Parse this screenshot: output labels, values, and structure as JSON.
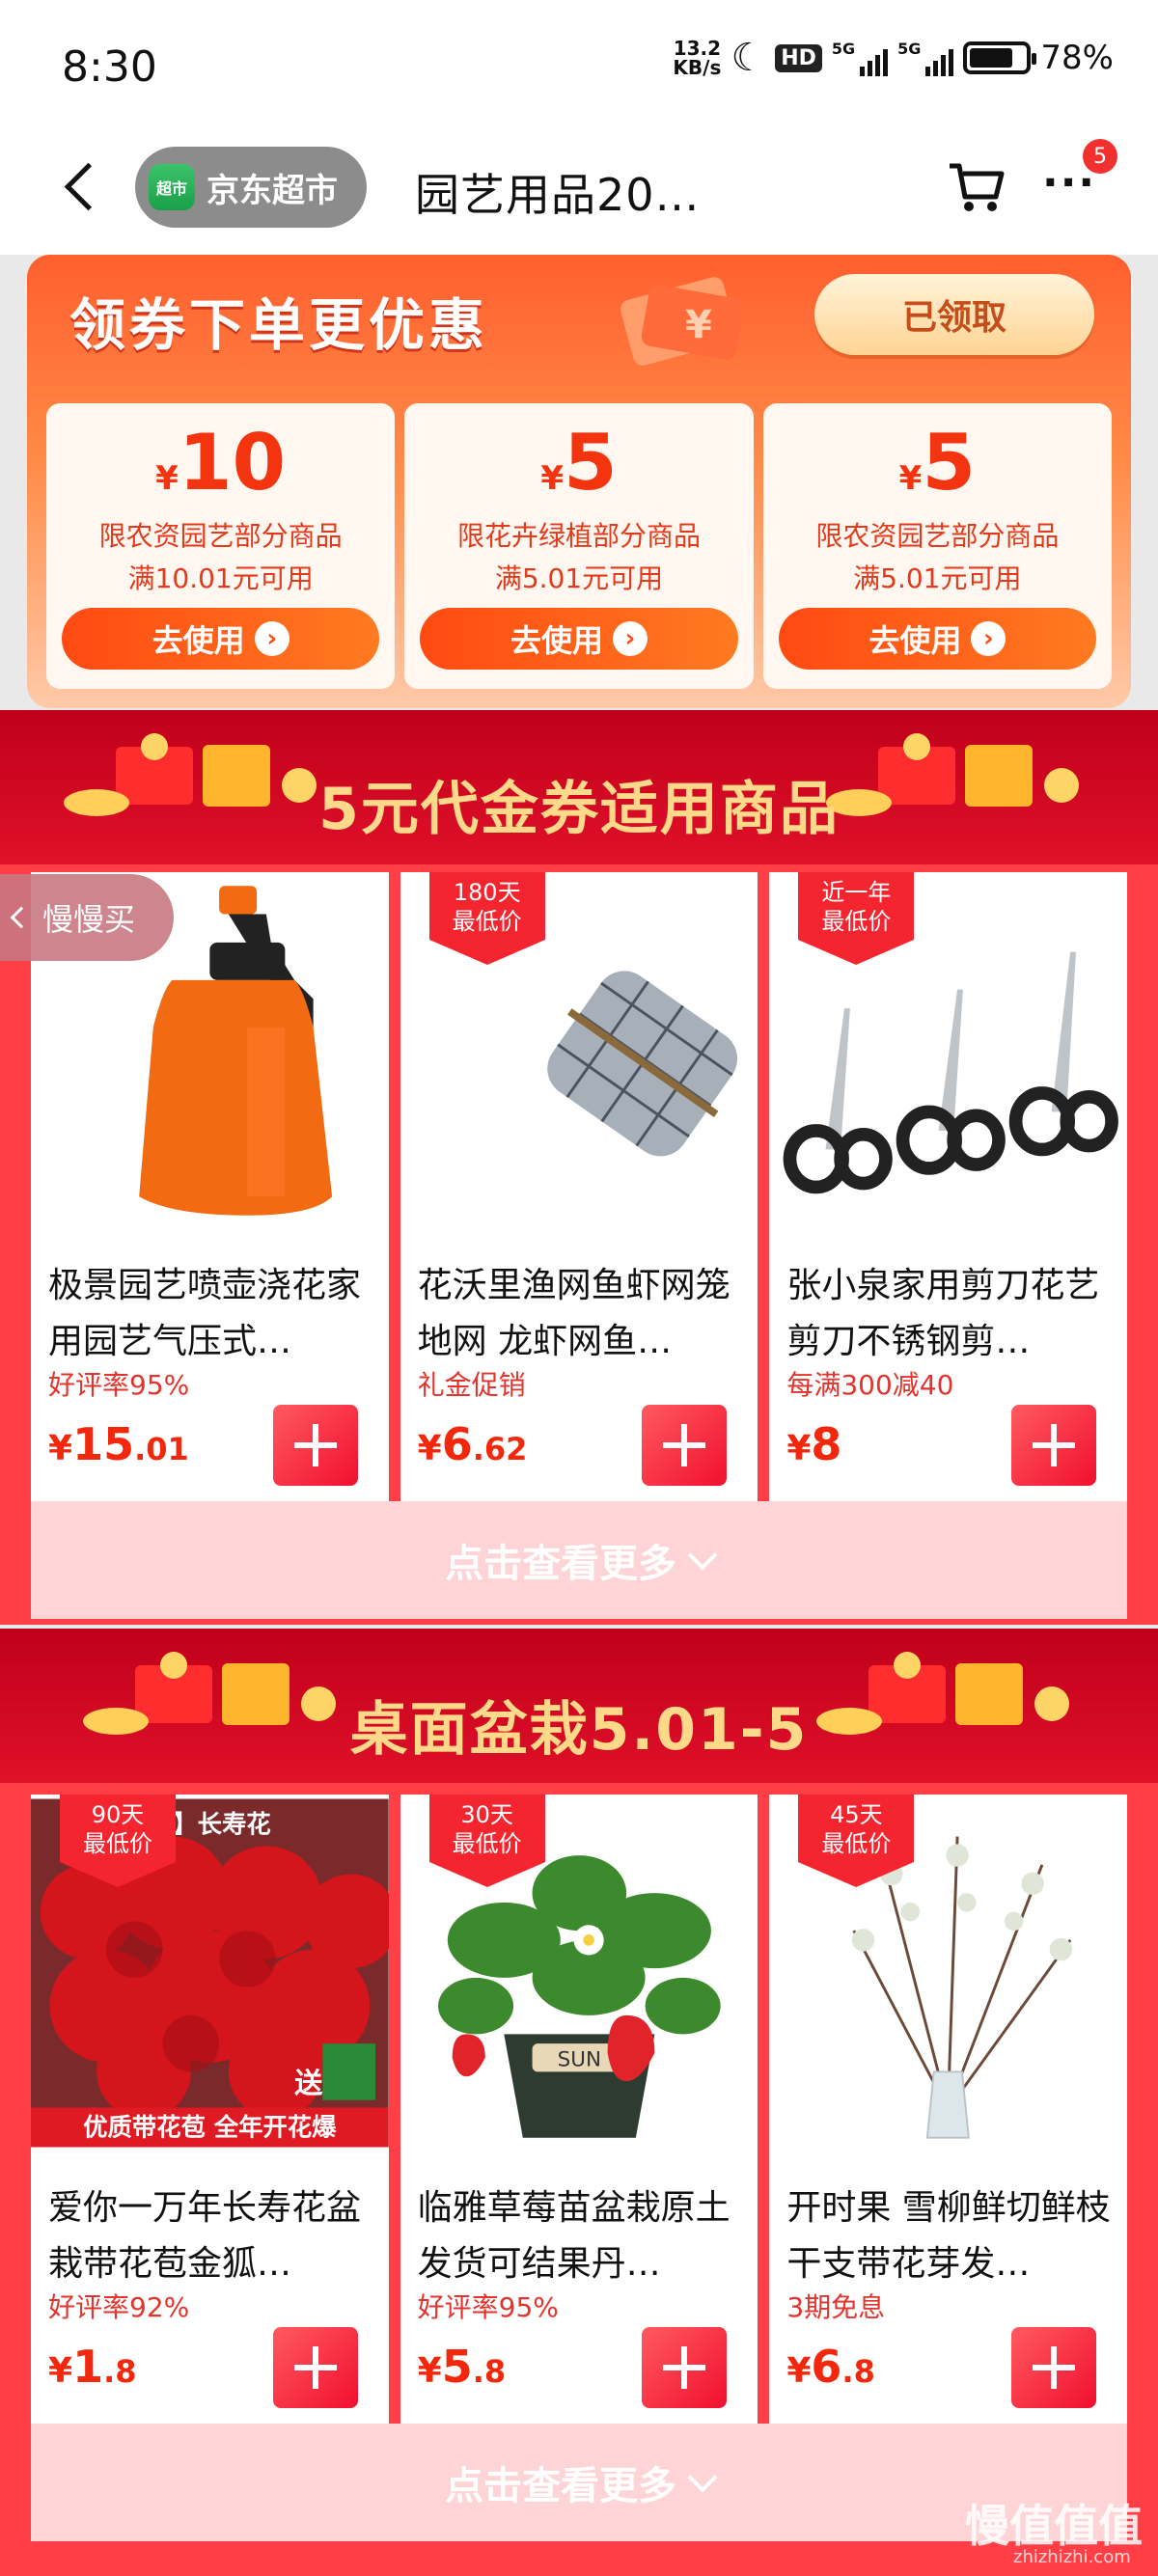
{
  "status_bar": {
    "time": "8:30",
    "net_speed_top": "13.2",
    "net_speed_bottom": "KB/s",
    "hd": "HD",
    "net1": "5G",
    "net2": "5G",
    "battery": "78%",
    "battery_level": 0.78
  },
  "header": {
    "store_badge": "超市",
    "store_name": "京东超市",
    "title": "园艺用品20…",
    "more_badge": "5"
  },
  "coupons": {
    "headline": "领券下单更优惠",
    "claimed_label": "已领取",
    "items": [
      {
        "yen": "¥",
        "amount": "10",
        "scope": "限农资园艺部分商品",
        "condition": "满10.01元可用",
        "button": "去使用"
      },
      {
        "yen": "¥",
        "amount": "5",
        "scope": "限花卉绿植部分商品",
        "condition": "满5.01元可用",
        "button": "去使用"
      },
      {
        "yen": "¥",
        "amount": "5",
        "scope": "限农资园艺部分商品",
        "condition": "满5.01元可用",
        "button": "去使用"
      }
    ]
  },
  "slow_buy_label": "慢慢买",
  "section1": {
    "title": "5元代金券适用商品",
    "see_more": "点击查看更多",
    "products": [
      {
        "tag_top": "",
        "tag_bottom": "",
        "name": "极景园艺喷壶浇花家用园艺气压式…",
        "sub": "好评率95%",
        "yen": "¥",
        "int": "15",
        "dec": ".01"
      },
      {
        "tag_top": "180天",
        "tag_bottom": "最低价",
        "name": "花沃里渔网鱼虾网笼地网 龙虾网鱼…",
        "sub": "礼金促销",
        "yen": "¥",
        "int": "6",
        "dec": ".62"
      },
      {
        "tag_top": "近一年",
        "tag_bottom": "最低价",
        "name": "张小泉家用剪刀花艺剪刀不锈钢剪…",
        "sub": "每满300减40",
        "yen": "¥",
        "int": "8",
        "dec": ""
      }
    ]
  },
  "section2": {
    "title": "桌面盆栽5.01-5",
    "see_more": "点击查看更多",
    "products": [
      {
        "tag_top": "90天",
        "tag_bottom": "最低价",
        "name": "爱你一万年长寿花盆栽带花苞金狐…",
        "sub": "好评率92%",
        "yen": "¥",
        "int": "1",
        "dec": ".8",
        "img_text_top": "红】长寿花",
        "img_text_gift": "送",
        "img_caption": "优质带花苞 全年开花爆"
      },
      {
        "tag_top": "30天",
        "tag_bottom": "最低价",
        "name": "临雅草莓苗盆栽原土发货可结果丹…",
        "sub": "好评率95%",
        "yen": "¥",
        "int": "5",
        "dec": ".8",
        "img_text_pot": "SUN"
      },
      {
        "tag_top": "45天",
        "tag_bottom": "最低价",
        "name": "开时果 雪柳鲜切鲜枝干支带花芽发…",
        "sub": "3期免息",
        "yen": "¥",
        "int": "6",
        "dec": ".8"
      }
    ]
  },
  "watermark": {
    "text": "慢值值值",
    "url": "zhizhizhi.com"
  }
}
